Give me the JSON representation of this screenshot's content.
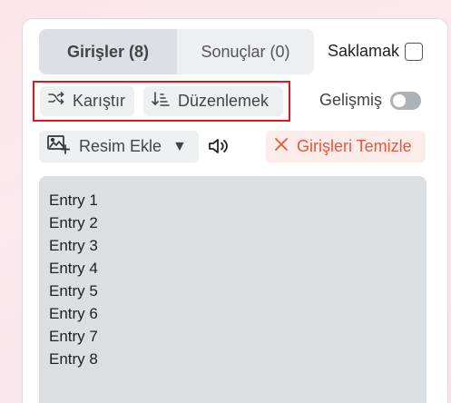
{
  "tabs": [
    {
      "label": "Girişler (8)",
      "active": true
    },
    {
      "label": "Sonuçlar (0)",
      "active": false
    }
  ],
  "hide": {
    "label": "Saklamak",
    "checked": false
  },
  "actions": {
    "shuffle_label": "Karıştır",
    "sort_label": "Düzenlemek"
  },
  "advanced": {
    "label": "Gelişmiş",
    "enabled": false
  },
  "image_button": {
    "label": "Resim Ekle",
    "caret": "▼"
  },
  "clear_button": {
    "label": "Girişleri Temizle",
    "icon": "×"
  },
  "entries": [
    "Entry 1",
    "Entry 2",
    "Entry 3",
    "Entry 4",
    "Entry 5",
    "Entry 6",
    "Entry 7",
    "Entry 8"
  ],
  "colors": {
    "accent_red": "#e2161e",
    "clear_text": "#e5563f",
    "clear_bg": "#fcece9",
    "button_bg": "#eeeff1",
    "textarea_bg": "#dcdfe2"
  },
  "icons": {
    "shuffle": "shuffle-icon",
    "sort": "sort-descending-icon",
    "image": "add-image-icon",
    "sound": "speaker-icon",
    "clear": "close-icon"
  }
}
